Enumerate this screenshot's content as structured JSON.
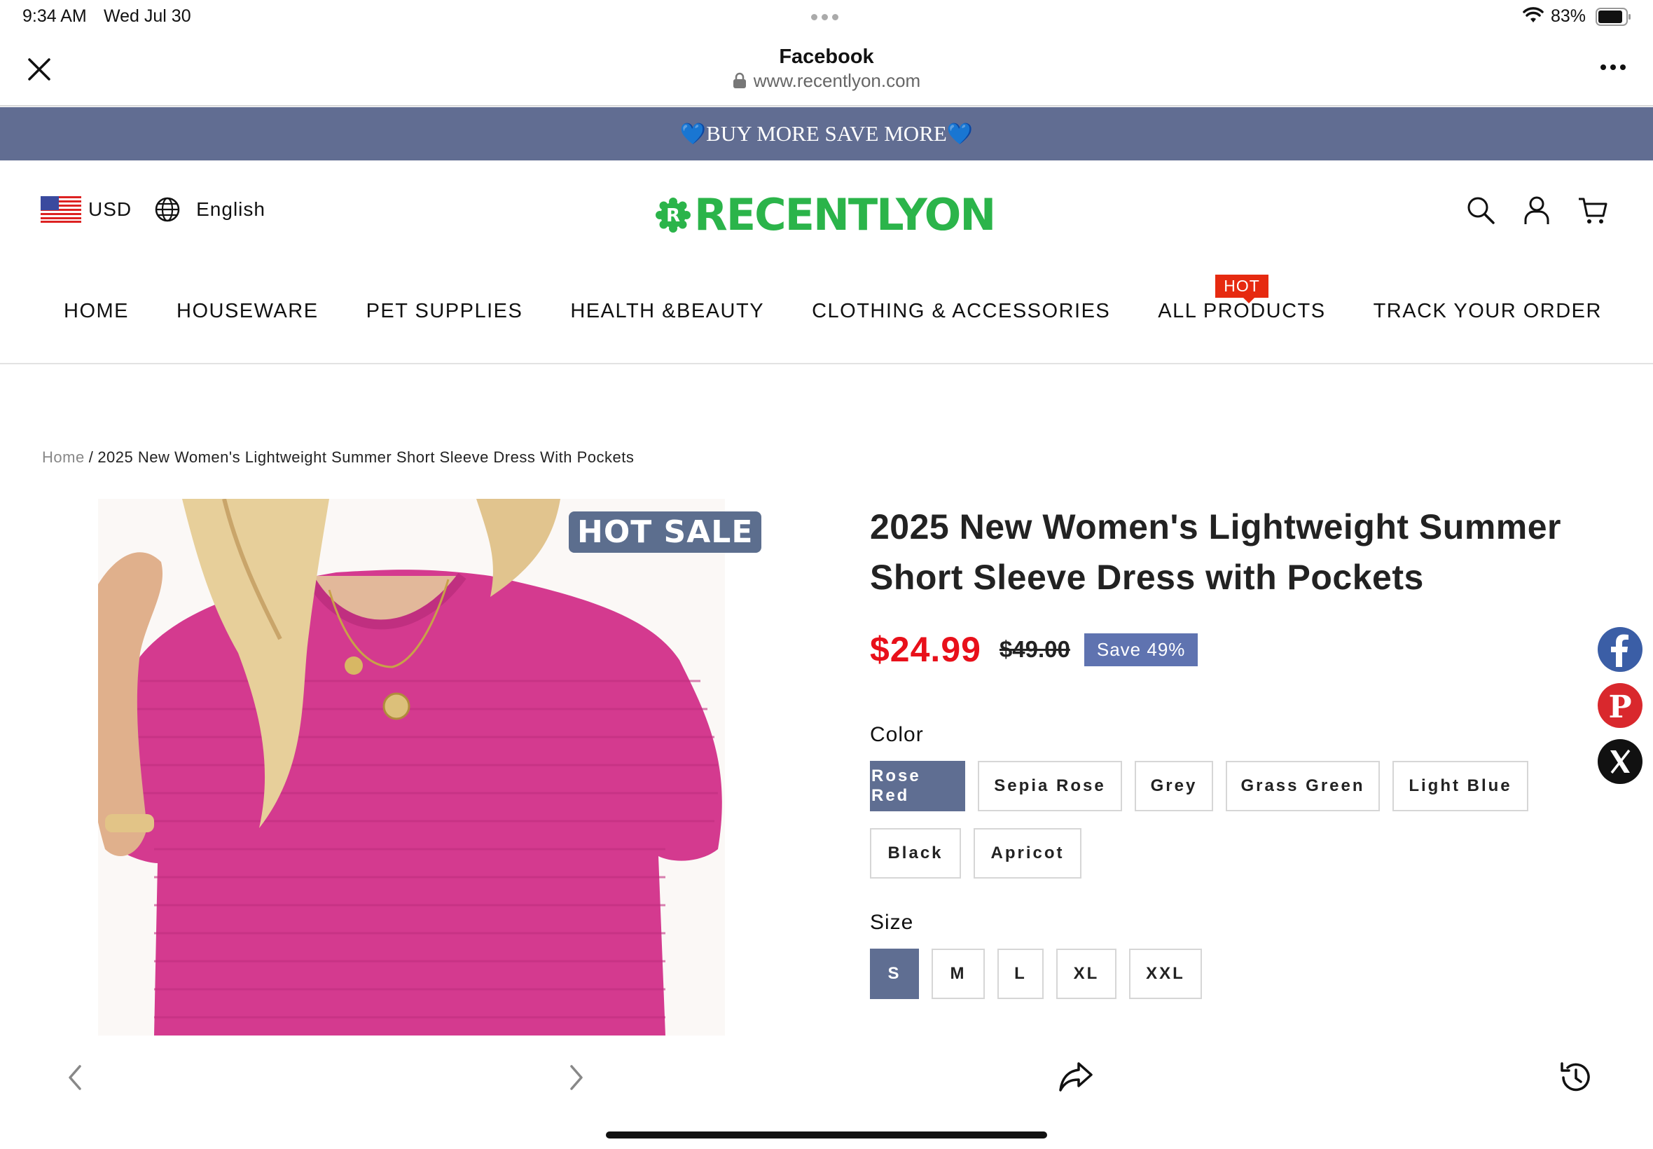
{
  "status_bar": {
    "time": "9:34 AM",
    "date": "Wed Jul 30",
    "battery_pct": "83%"
  },
  "browser": {
    "title": "Facebook",
    "url": "www.recentlyon.com"
  },
  "promo": {
    "text": "BUY MORE SAVE MORE",
    "heart_left": "💙",
    "heart_right": "💙"
  },
  "header": {
    "currency": "USD",
    "language": "English",
    "logo_text": "RECENTLYON",
    "logo_color": "#2bb44a"
  },
  "nav": {
    "items": [
      "HOME",
      "HOUSEWARE",
      "PET SUPPLIES",
      "HEALTH &BEAUTY",
      "CLOTHING & ACCESSORIES",
      "ALL PRODUCTS",
      "TRACK YOUR ORDER"
    ],
    "hot_badge": "HOT"
  },
  "breadcrumb": {
    "home": "Home",
    "separator": "/",
    "current": "2025 New Women's Lightweight Summer Short Sleeve Dress With Pockets"
  },
  "product": {
    "badge": "HOT SALE",
    "title_line1": "2025 New Women's Lightweight Summer",
    "title_line2": "Short Sleeve Dress with Pockets",
    "price": "$24.99",
    "compare_price": "$49.00",
    "save_label": "Save 49%",
    "color_label": "Color",
    "colors": [
      "Rose Red",
      "Sepia Rose",
      "Grey",
      "Grass Green",
      "Light Blue",
      "Black",
      "Apricot"
    ],
    "selected_color": "Rose Red",
    "size_label": "Size",
    "sizes": [
      "S",
      "M",
      "L",
      "XL",
      "XXL"
    ],
    "selected_size": "S",
    "accent_color": "#5f6e92",
    "price_color": "#e8101a"
  },
  "share": [
    "facebook-icon",
    "pinterest-icon",
    "x-icon"
  ]
}
